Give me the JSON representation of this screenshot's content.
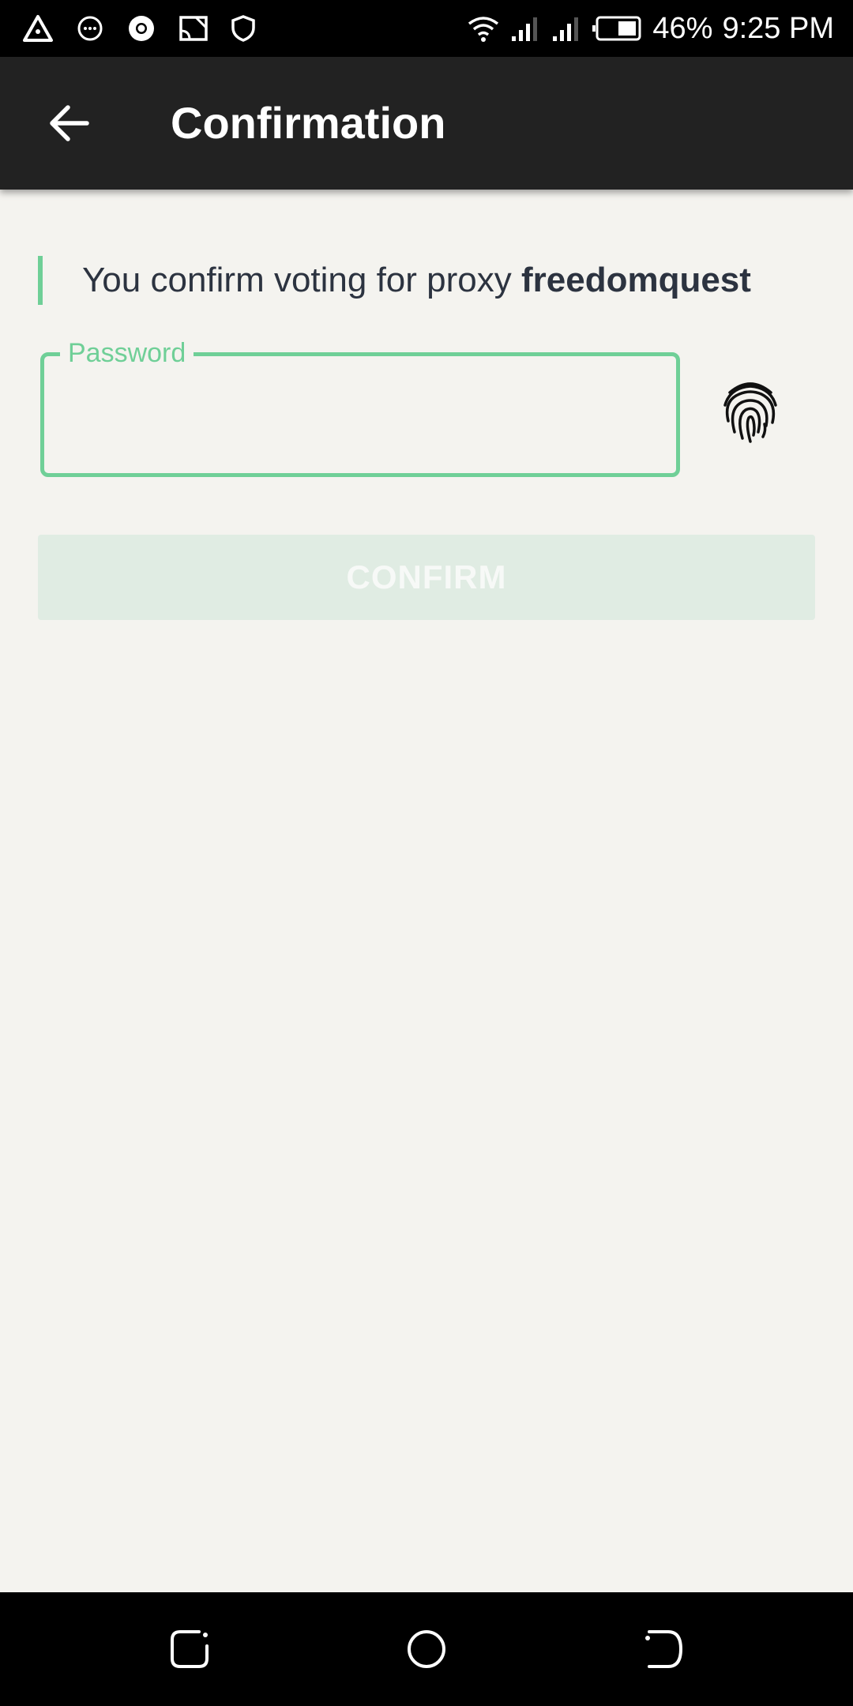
{
  "status_bar": {
    "battery": "46%",
    "time": "9:25 PM",
    "left_icons": [
      "delta-icon",
      "chat-icon",
      "chrome-icon",
      "cast-icon",
      "shield-icon"
    ],
    "right_icons": [
      "wifi-icon",
      "signal-icon",
      "signal-icon",
      "battery-icon"
    ]
  },
  "app_bar": {
    "title": "Confirmation",
    "back_icon": "arrow-left-icon"
  },
  "notice": {
    "prefix": "You confirm voting for proxy ",
    "proxy_name": "freedomquest"
  },
  "password": {
    "label": "Password",
    "value": "",
    "placeholder": ""
  },
  "fingerprint_icon": "fingerprint-icon",
  "confirm_button": {
    "label": "CONFIRM",
    "enabled": false
  },
  "colors": {
    "accent": "#6fcf97",
    "app_bar": "#222222",
    "background": "#f4f3ef",
    "button_disabled": "#e0ece3",
    "text": "#2c3340"
  },
  "nav_bar": {
    "icons": [
      "recents-icon",
      "home-icon",
      "back-nav-icon"
    ]
  }
}
